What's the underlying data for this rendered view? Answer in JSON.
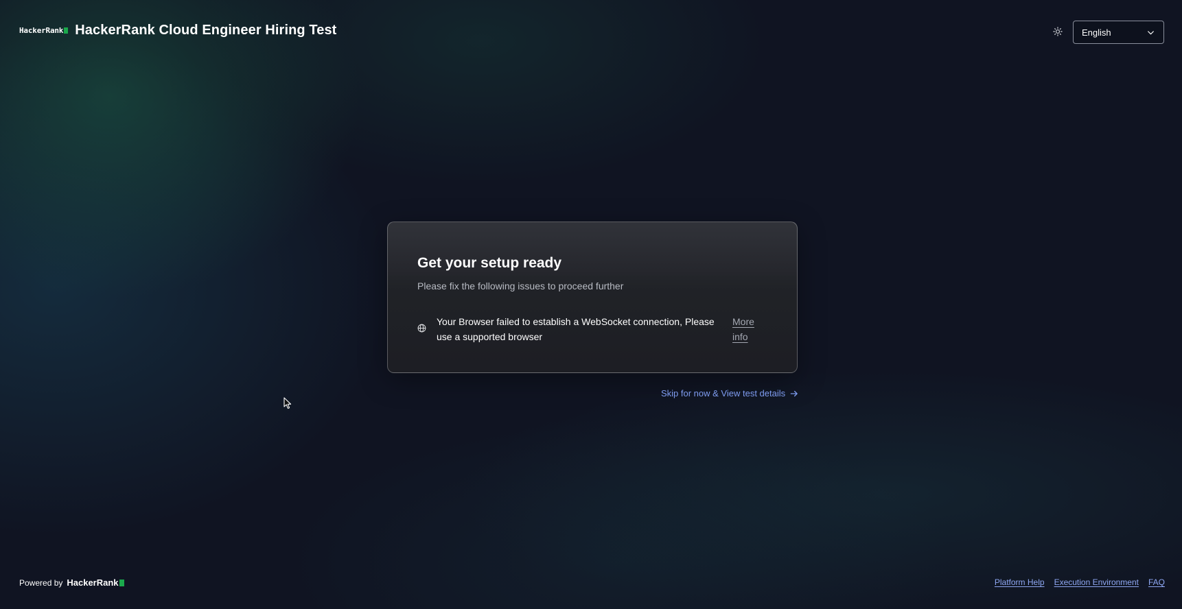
{
  "header": {
    "logo_text": "HackerRank",
    "title": "HackerRank Cloud Engineer Hiring Test",
    "theme_icon": "sun-icon",
    "language": {
      "selected": "English",
      "icon": "chevron-down-icon"
    }
  },
  "card": {
    "title": "Get your setup ready",
    "subtitle": "Please fix the following issues to proceed further",
    "issues": [
      {
        "icon": "globe-icon",
        "text": "Your Browser failed to establish a WebSocket connection, Please use a supported browser",
        "link_label": "More info"
      }
    ]
  },
  "skip": {
    "label": "Skip for now & View test details",
    "icon": "arrow-right-icon"
  },
  "footer": {
    "powered_by": "Powered by",
    "brand": "HackerRank",
    "links": [
      {
        "label": "Platform Help"
      },
      {
        "label": "Execution Environment"
      },
      {
        "label": "FAQ"
      }
    ]
  },
  "colors": {
    "background": "#101422",
    "brand_green": "#1ba94c",
    "link_blue": "#7e9cf0",
    "card_border": "#5a5c62"
  }
}
